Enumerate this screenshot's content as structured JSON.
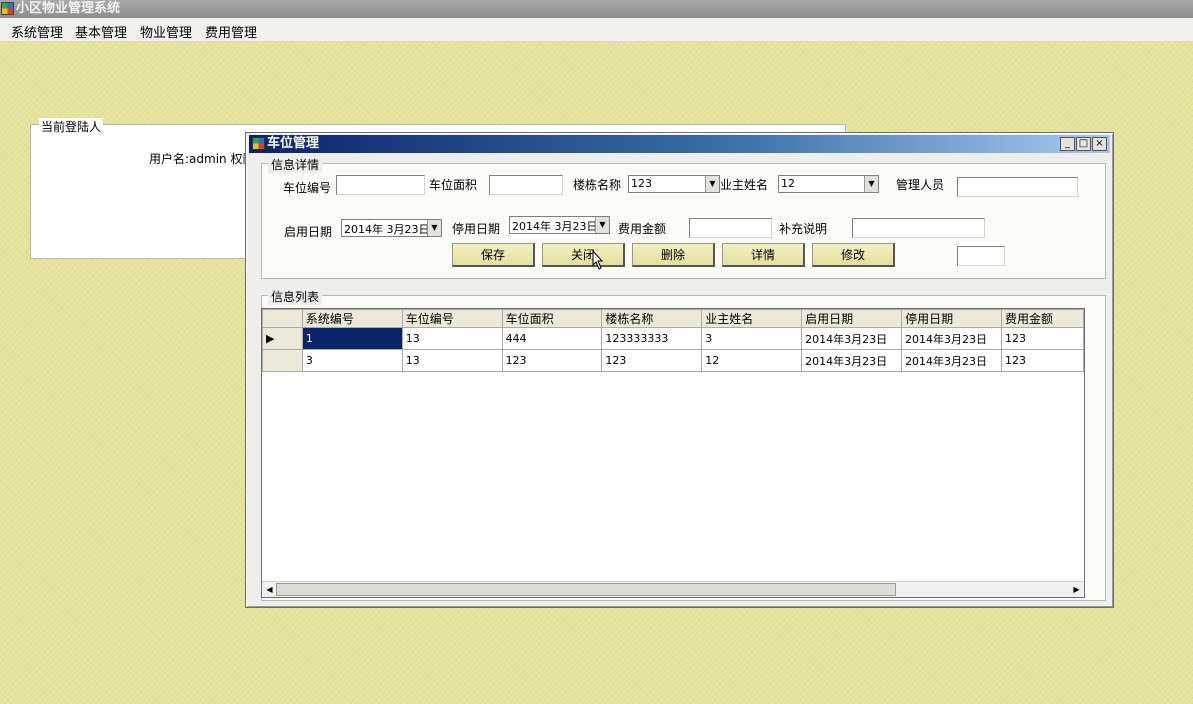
{
  "app": {
    "title": "小区物业管理系统"
  },
  "menu": [
    "系统管理",
    "基本管理",
    "物业管理",
    "费用管理"
  ],
  "login_panel": {
    "legend": "当前登陆人",
    "user_text": "用户名:admin 权限"
  },
  "dialog": {
    "title": "车位管理",
    "caption_buttons": {
      "min": "_",
      "max": "□",
      "close": "×"
    },
    "details": {
      "legend": "信息详情",
      "labels": {
        "space_no": "车位编号",
        "area": "车位面积",
        "building": "楼栋名称",
        "owner": "业主姓名",
        "manager": "管理人员",
        "start_date": "启用日期",
        "end_date": "停用日期",
        "fee": "费用金额",
        "remarks": "补充说明"
      },
      "values": {
        "space_no": "",
        "area": "",
        "building": "123",
        "owner": "12",
        "manager": "",
        "start_date": "2014年  3月23日",
        "end_date": "2014年  3月23日",
        "fee": "",
        "remarks": "",
        "extra": ""
      },
      "buttons": {
        "save": "保存",
        "close": "关闭",
        "delete": "删除",
        "detail": "详情",
        "edit": "修改"
      }
    },
    "list": {
      "legend": "信息列表",
      "columns": [
        "系统编号",
        "车位编号",
        "车位面积",
        "楼栋名称",
        "业主姓名",
        "启用日期",
        "停用日期",
        "费用金额"
      ],
      "rows": [
        [
          "1",
          "13",
          "444",
          "123333333",
          "3",
          "2014年3月23日",
          "2014年3月23日",
          "123"
        ],
        [
          "3",
          "13",
          "123",
          "123",
          "12",
          "2014年3月23日",
          "2014年3月23日",
          "123"
        ]
      ],
      "selected_row": 0
    }
  }
}
